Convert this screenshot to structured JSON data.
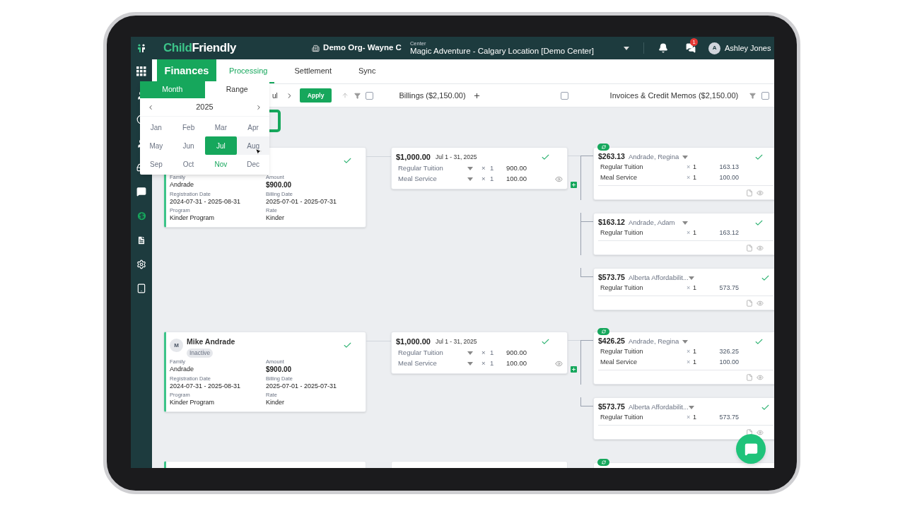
{
  "topbar": {
    "brand_first": "Child",
    "brand_second": "Friendly",
    "org": "Demo Org- Wayne C",
    "center_label": "Center",
    "center": "Magic Adventure - Calgary Location [Demo Center]",
    "message_count": "1",
    "user_initial": "A",
    "user": "Ashley Jones"
  },
  "module": "Finances",
  "tabs": [
    {
      "label": "Processing",
      "selected": true
    },
    {
      "label": "Settlement",
      "selected": false
    },
    {
      "label": "Sync",
      "selected": false
    }
  ],
  "toolbar": {
    "date_fragment": "ul",
    "apply": "Apply",
    "filter_checked": false,
    "billings": "Billings ($2,150.00)",
    "billings_checked": false,
    "invoices": "Invoices & Credit Memos ($2,150.00)",
    "invoices_checked": false
  },
  "month_picker": {
    "modes": [
      {
        "label": "Month",
        "selected": true
      },
      {
        "label": "Range",
        "selected": false
      }
    ],
    "year": "2025",
    "months": [
      {
        "label": "Jan",
        "selected": false,
        "current": false,
        "hovered": false
      },
      {
        "label": "Feb",
        "selected": false,
        "current": false,
        "hovered": false
      },
      {
        "label": "Mar",
        "selected": false,
        "current": false,
        "hovered": false
      },
      {
        "label": "Apr",
        "selected": false,
        "current": false,
        "hovered": false
      },
      {
        "label": "May",
        "selected": false,
        "current": false,
        "hovered": false
      },
      {
        "label": "Jun",
        "selected": false,
        "current": false,
        "hovered": false
      },
      {
        "label": "Jul",
        "selected": true,
        "current": false,
        "hovered": false
      },
      {
        "label": "Aug",
        "selected": false,
        "current": false,
        "hovered": true
      },
      {
        "label": "Sep",
        "selected": false,
        "current": false,
        "hovered": false
      },
      {
        "label": "Oct",
        "selected": false,
        "current": false,
        "hovered": false
      },
      {
        "label": "Nov",
        "selected": false,
        "current": true,
        "hovered": false
      },
      {
        "label": "Dec",
        "selected": false,
        "current": false,
        "hovered": false
      }
    ]
  },
  "groups": [
    {
      "child": {
        "approved": true,
        "family_label": "Family",
        "family": "Andrade",
        "amount_label": "Amount",
        "amount": "$900.00",
        "registration_label": "Registration Date",
        "registration": "2024-07-31 - 2025-08-31",
        "billing_label": "Billing Date",
        "billing": "2025-07-01 - 2025-07-31",
        "program_label": "Program",
        "program": "Kinder Program",
        "rate_label": "Rate",
        "rate": "Kinder"
      },
      "billing": {
        "amount": "$1,000.00",
        "period": "Jul 1 - 31, 2025",
        "approved": true,
        "lines": [
          {
            "item": "Regular Tuition",
            "times": "×",
            "qty": "1",
            "total": "900.00"
          },
          {
            "item": "Meal Service",
            "times": "×",
            "qty": "1",
            "total": "100.00"
          }
        ]
      },
      "invoices": [
        {
          "synced": true,
          "amount": "$263.13",
          "payer": "Andrade, Regina",
          "approved": true,
          "lines": [
            {
              "item": "Regular Tuition",
              "times": "×",
              "qty": "1",
              "total": "163.13"
            },
            {
              "item": "Meal Service",
              "times": "×",
              "qty": "1",
              "total": "100.00"
            }
          ]
        },
        {
          "synced": false,
          "amount": "$163.12",
          "payer": "Andrade, Adam",
          "approved": true,
          "lines": [
            {
              "item": "Regular Tuition",
              "times": "×",
              "qty": "1",
              "total": "163.12"
            }
          ]
        },
        {
          "synced": false,
          "amount": "$573.75",
          "payer": "Alberta Affordabilit...",
          "approved": true,
          "lines": [
            {
              "item": "Regular Tuition",
              "times": "×",
              "qty": "1",
              "total": "573.75"
            }
          ]
        }
      ]
    },
    {
      "child": {
        "avatar": "M",
        "name": "Mike Andrade",
        "status": "Inactive",
        "approved": true,
        "family_label": "Family",
        "family": "Andrade",
        "amount_label": "Amount",
        "amount": "$900.00",
        "registration_label": "Registration Date",
        "registration": "2024-07-31 - 2025-08-31",
        "billing_label": "Billing Date",
        "billing": "2025-07-01 - 2025-07-31",
        "program_label": "Program",
        "program": "Kinder Program",
        "rate_label": "Rate",
        "rate": "Kinder"
      },
      "billing": {
        "amount": "$1,000.00",
        "period": "Jul 1 - 31, 2025",
        "approved": true,
        "lines": [
          {
            "item": "Regular Tuition",
            "times": "×",
            "qty": "1",
            "total": "900.00"
          },
          {
            "item": "Meal Service",
            "times": "×",
            "qty": "1",
            "total": "100.00"
          }
        ]
      },
      "invoices": [
        {
          "synced": true,
          "amount": "$426.25",
          "payer": "Andrade, Regina",
          "approved": true,
          "lines": [
            {
              "item": "Regular Tuition",
              "times": "×",
              "qty": "1",
              "total": "326.25"
            },
            {
              "item": "Meal Service",
              "times": "×",
              "qty": "1",
              "total": "100.00"
            }
          ]
        },
        {
          "synced": false,
          "amount": "$573.75",
          "payer": "Alberta Affordabilit...",
          "approved": true,
          "lines": [
            {
              "item": "Regular Tuition",
              "times": "×",
              "qty": "1",
              "total": "573.75"
            }
          ]
        }
      ]
    }
  ],
  "next_row": {
    "invoice_synced": true
  }
}
